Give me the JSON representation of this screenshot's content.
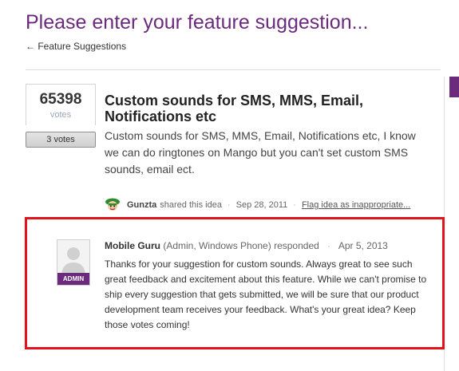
{
  "header": {
    "title": "Please enter your feature suggestion...",
    "back_link": "← Feature Suggestions"
  },
  "idea": {
    "vote_count": "65398",
    "vote_label": "votes",
    "vote_button_label": "3 votes",
    "title": "Custom sounds for SMS, MMS, Email, Notifications etc",
    "body": "Custom sounds for SMS, MMS, Email, Notifications etc, I know we can do ringtones on Mango but you can't set custom SMS sounds, email ect.",
    "author": "Gunzta",
    "shared_text": "shared this idea",
    "separator": "·",
    "date": "Sep 28, 2011",
    "flag_link": "Flag idea as inappropriate..."
  },
  "response": {
    "badge": "ADMIN",
    "responder": "Mobile Guru",
    "role": "(Admin, Windows Phone)",
    "responded_text": "responded",
    "separator": "·",
    "date": "Apr 5, 2013",
    "text": "Thanks for your suggestion for custom sounds. Always great to see such great feedback and excitement about this feature. While we can't promise to ship every suggestion that gets submitted, we will be sure that our product development team receives your feedback. What's your great idea? Keep those votes coming!"
  },
  "colors": {
    "brand_purple": "#6b2a7c",
    "highlight_red": "#e4121d"
  }
}
